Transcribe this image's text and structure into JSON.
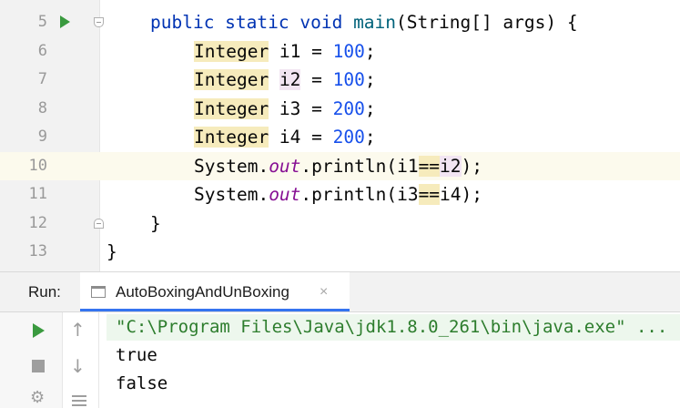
{
  "editor": {
    "lines": [
      {
        "number": "5"
      },
      {
        "number": "6"
      },
      {
        "number": "7"
      },
      {
        "number": "8"
      },
      {
        "number": "9"
      },
      {
        "number": "10"
      },
      {
        "number": "11"
      },
      {
        "number": "12"
      },
      {
        "number": "13"
      }
    ],
    "code": {
      "l5_kw": "public static void ",
      "l5_name": "main",
      "l5_rest": "(String[] args) {",
      "type": "Integer",
      "i1": " i1 = ",
      "i2_pre": " ",
      "i2_var": "i2",
      "i2_post": " = ",
      "i3": " i3 = ",
      "i4": " i4 = ",
      "v100a": "100",
      "v100b": "100",
      "v200a": "200",
      "v200b": "200",
      "semi": ";",
      "sys": "System.",
      "out": "out",
      "println_a": ".println(i1",
      "eq": "==",
      "i2_ref": "i2",
      "close_a": ");",
      "println_b": ".println(i3",
      "i4_ref": "i4);",
      "brace_method": "}",
      "brace_class": "}"
    }
  },
  "run_panel": {
    "label": "Run:",
    "tab_title": "AutoBoxingAndUnBoxing",
    "tab_close": "×",
    "console": [
      "\"C:\\Program Files\\Java\\jdk1.8.0_261\\bin\\java.exe\" ...",
      "true",
      "false"
    ]
  },
  "icons": {
    "run_gutter": "run-arrow-icon",
    "rerun": "rerun-icon",
    "stop": "stop-icon",
    "settings": "settings-icon",
    "scroll_up": "arrow-up-icon",
    "scroll_down": "arrow-down-icon",
    "soft_wrap": "soft-wrap-icon"
  },
  "colors": {
    "keyword": "#0033b3",
    "number": "#1750eb",
    "static_field": "#871094",
    "run_green": "#3a9a3f",
    "tab_accent": "#3574f0",
    "current_line": "#fcfaed"
  }
}
